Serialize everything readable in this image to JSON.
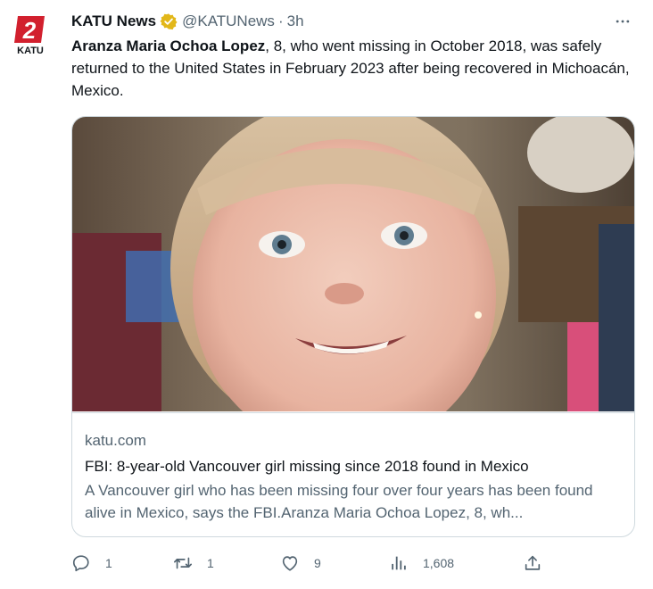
{
  "account": {
    "avatar_text": "KATU",
    "avatar_number": "2",
    "name": "KATU News",
    "handle": "@KATUNews",
    "separator": "·",
    "time": "3h"
  },
  "tweet": {
    "bold_name": "Aranza Maria Ochoa Lopez",
    "text_rest": ", 8, who went missing in October 2018, was safely returned to the United States in February 2023 after being recovered in Michoacán, Mexico."
  },
  "card": {
    "domain": "katu.com",
    "headline": "FBI: 8-year-old Vancouver girl missing since 2018 found in Mexico",
    "description": "A Vancouver girl who has been missing four over four years has been found alive in Mexico, says the FBI.Aranza Maria Ochoa Lopez, 8, wh..."
  },
  "actions": {
    "replies": "1",
    "retweets": "1",
    "likes": "9",
    "views": "1,608"
  },
  "icons": {
    "verified": "gold-verified-badge-icon",
    "more": "more-options-icon",
    "reply": "reply-icon",
    "retweet": "retweet-icon",
    "like": "heart-icon",
    "views": "views-bar-chart-icon",
    "share": "share-icon"
  },
  "colors": {
    "text_primary": "#0f1419",
    "text_secondary": "#536471",
    "border": "#cfd9de",
    "verified_gold": "#e2b719",
    "brand_red": "#d2202e"
  }
}
